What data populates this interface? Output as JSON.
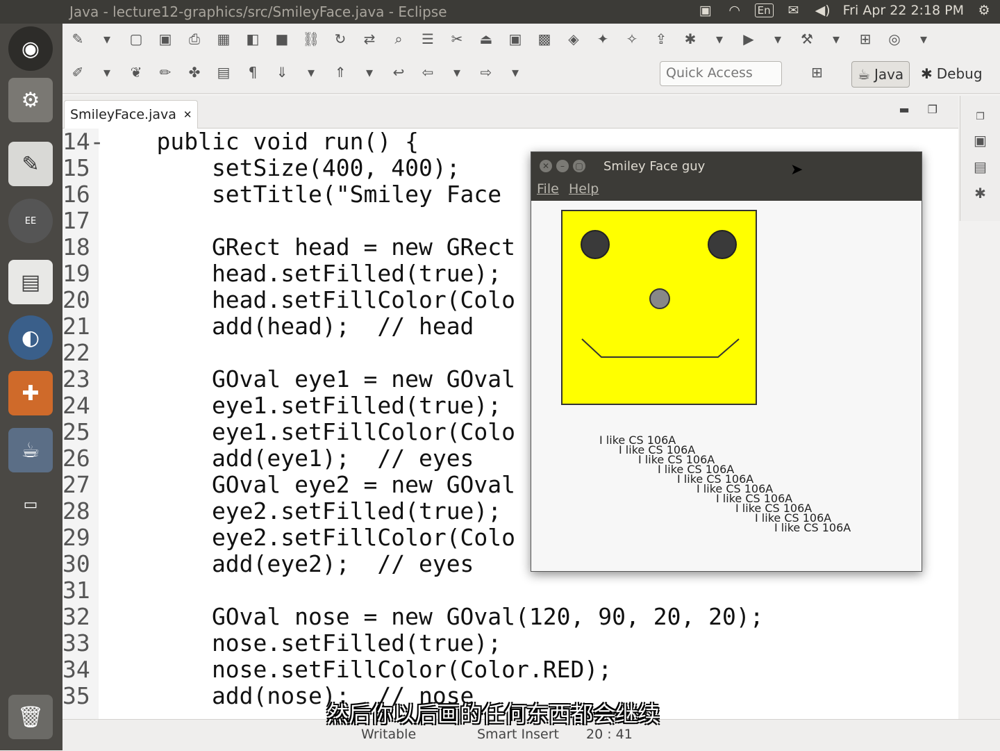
{
  "topbar": {
    "title": "Java - lecture12-graphics/src/SmileyFace.java - Eclipse",
    "lang": "En",
    "datetime": "Fri Apr 22  2:18 PM",
    "icons": [
      "camera-icon",
      "wifi-icon",
      "keyboard-language-icon",
      "mail-icon",
      "volume-icon",
      "gear-icon"
    ]
  },
  "launcher": {
    "items": [
      "ubuntu-dash-icon",
      "system-settings-icon",
      "eclipse-java-ee-icon",
      "presentation-icon",
      "browser-icon",
      "software-center-icon",
      "java-icon",
      "workspace-icon",
      "trash-icon"
    ]
  },
  "toolbar": {
    "quick_access": "Quick Access",
    "perspective_java": "Java",
    "perspective_debug": "Debug"
  },
  "editor": {
    "tab_label": "SmileyFace.java",
    "tab_close": "✕",
    "lines": [
      {
        "n": "14-",
        "t": "    public void run() {"
      },
      {
        "n": "15",
        "t": "        setSize(400, 400);"
      },
      {
        "n": "16",
        "t": "        setTitle(\"Smiley Face"
      },
      {
        "n": "17",
        "t": ""
      },
      {
        "n": "18",
        "t": "        GRect head = new GRect"
      },
      {
        "n": "19",
        "t": "        head.setFilled(true);"
      },
      {
        "n": "20",
        "t": "        head.setFillColor(Colo"
      },
      {
        "n": "21",
        "t": "        add(head);  // head"
      },
      {
        "n": "22",
        "t": ""
      },
      {
        "n": "23",
        "t": "        GOval eye1 = new GOval"
      },
      {
        "n": "24",
        "t": "        eye1.setFilled(true);"
      },
      {
        "n": "25",
        "t": "        eye1.setFillColor(Colo"
      },
      {
        "n": "26",
        "t": "        add(eye1);  // eyes"
      },
      {
        "n": "27",
        "t": "        GOval eye2 = new GOval"
      },
      {
        "n": "28",
        "t": "        eye2.setFilled(true);"
      },
      {
        "n": "29",
        "t": "        eye2.setFillColor(Colo"
      },
      {
        "n": "30",
        "t": "        add(eye2);  // eyes"
      },
      {
        "n": "31",
        "t": ""
      },
      {
        "n": "32",
        "t": "        GOval nose = new GOval(120, 90, 20, 20);"
      },
      {
        "n": "33",
        "t": "        nose.setFilled(true);"
      },
      {
        "n": "34",
        "t": "        nose.setFillColor(Color.RED);"
      },
      {
        "n": "35",
        "t": "        add(nose);  // nose"
      }
    ]
  },
  "statusbar": {
    "writable": "Writable",
    "insert_mode": "Smart Insert",
    "position": "20 : 41"
  },
  "subtitle": "然后你以后画的任何东西都会继续",
  "dialog": {
    "title": "Smiley Face guy",
    "menu_file": "File",
    "menu_help": "Help",
    "like_text": "I like CS 106A",
    "like_count": 10,
    "colors": {
      "head": "#ffff00",
      "eyes": "#3a3a3a",
      "nose": "#888888"
    }
  }
}
